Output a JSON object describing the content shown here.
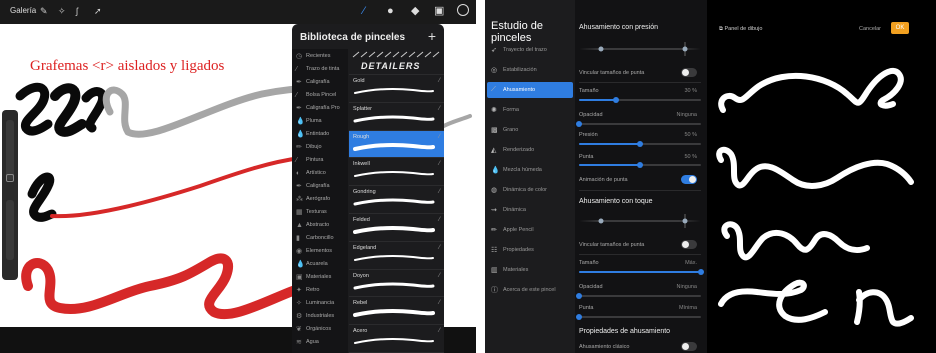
{
  "left_app": {
    "gallery_label": "Galería",
    "canvas_title": "Grafemas <r> aislados y ligados",
    "colors": {
      "red_stroke": "#d62828",
      "gray_stroke": "#a6a6a6",
      "black_stroke": "#0a0a0a",
      "title_red": "#d22222"
    }
  },
  "library": {
    "title": "Biblioteca de pinceles",
    "add_icon": "+",
    "categories": [
      {
        "label": "Recientes",
        "icon": "clock"
      },
      {
        "label": "Trazo de tinta",
        "icon": "brush"
      },
      {
        "label": "Caligrafía",
        "icon": "pen"
      },
      {
        "label": "Bolsa Pincel",
        "icon": "brush"
      },
      {
        "label": "Caligrafía Pro",
        "icon": "pen"
      },
      {
        "label": "Pluma",
        "icon": "drop"
      },
      {
        "label": "Entintado",
        "icon": "drop"
      },
      {
        "label": "Dibujo",
        "icon": "pencil"
      },
      {
        "label": "Pintura",
        "icon": "brush"
      },
      {
        "label": "Artístico",
        "icon": "palette"
      },
      {
        "label": "Caligrafía",
        "icon": "pen"
      },
      {
        "label": "Aerógrafo",
        "icon": "spray"
      },
      {
        "label": "Texturas",
        "icon": "grid"
      },
      {
        "label": "Abstracto",
        "icon": "triangle"
      },
      {
        "label": "Carboncillo",
        "icon": "stick"
      },
      {
        "label": "Elementos",
        "icon": "circle"
      },
      {
        "label": "Acuarela",
        "icon": "drop"
      },
      {
        "label": "Materiales",
        "icon": "cube"
      },
      {
        "label": "Retro",
        "icon": "star"
      },
      {
        "label": "Luminancia",
        "icon": "sparkle"
      },
      {
        "label": "Industriales",
        "icon": "gear"
      },
      {
        "label": "Orgánicos",
        "icon": "leaf"
      },
      {
        "label": "Agua",
        "icon": "wave"
      }
    ],
    "header_banner": "DETAILERS",
    "brushes": [
      {
        "name": "Gold"
      },
      {
        "name": "Splatter"
      },
      {
        "name": "Rough",
        "selected": true
      },
      {
        "name": "Inkwell"
      },
      {
        "name": "Gondring"
      },
      {
        "name": "Felded"
      },
      {
        "name": "Edgeland"
      },
      {
        "name": "Doyon"
      },
      {
        "name": "Rebel"
      },
      {
        "name": "Acero"
      }
    ]
  },
  "studio": {
    "title": "Estudio de pinceles",
    "nav_items": [
      {
        "label": "Trayecto del trazo",
        "icon": "path"
      },
      {
        "label": "Estabilización",
        "icon": "swirl"
      },
      {
        "label": "Ahusamiento",
        "icon": "taper",
        "selected": true
      },
      {
        "label": "Forma",
        "icon": "shape"
      },
      {
        "label": "Grano",
        "icon": "grain"
      },
      {
        "label": "Renderizado",
        "icon": "render"
      },
      {
        "label": "Mezcla húmeda",
        "icon": "drop"
      },
      {
        "label": "Dinámica de color",
        "icon": "color"
      },
      {
        "label": "Dinámica",
        "icon": "dynamics"
      },
      {
        "label": "Apple Pencil",
        "icon": "pencil"
      },
      {
        "label": "Propiedades",
        "icon": "props"
      },
      {
        "label": "Materiales",
        "icon": "materials"
      },
      {
        "label": "Acerca de este pincel",
        "icon": "info"
      }
    ],
    "pressure_section": {
      "title": "Ahusamiento con presión",
      "link_tip_label": "Vincular tamaños de punta",
      "link_tip_on": false,
      "size_label": "Tamaño",
      "size_value": "30 %",
      "size_level": 0.3,
      "opacity_label": "Opacidad",
      "opacity_value": "Ninguna",
      "opacity_level": 0.0,
      "pressure_label": "Presión",
      "pressure_value": "50 %",
      "pressure_level": 0.5,
      "tip_label": "Punta",
      "tip_value": "50 %",
      "tip_level": 0.5,
      "tip_animation_label": "Animación de punta",
      "tip_animation_on": true
    },
    "touch_section": {
      "title": "Ahusamiento con toque",
      "link_tip_label": "Vincular tamaños de punta",
      "link_tip_on": false,
      "size_label": "Tamaño",
      "size_value": "Máx.",
      "size_level": 1.0,
      "opacity_label": "Opacidad",
      "opacity_value": "Ninguna",
      "opacity_level": 0.0,
      "tip_label": "Punta",
      "tip_value": "Mínima",
      "tip_level": 0.0
    },
    "props_section": {
      "title": "Propiedades de ahusamiento",
      "smooth_label": "Ahusamiento clásico",
      "smooth_on": false
    },
    "drawing_pad": {
      "label": "Panel de dibujo",
      "cancel_label": "Cancelar",
      "ok_label": "OK",
      "ok_color": "#f2a020"
    }
  }
}
